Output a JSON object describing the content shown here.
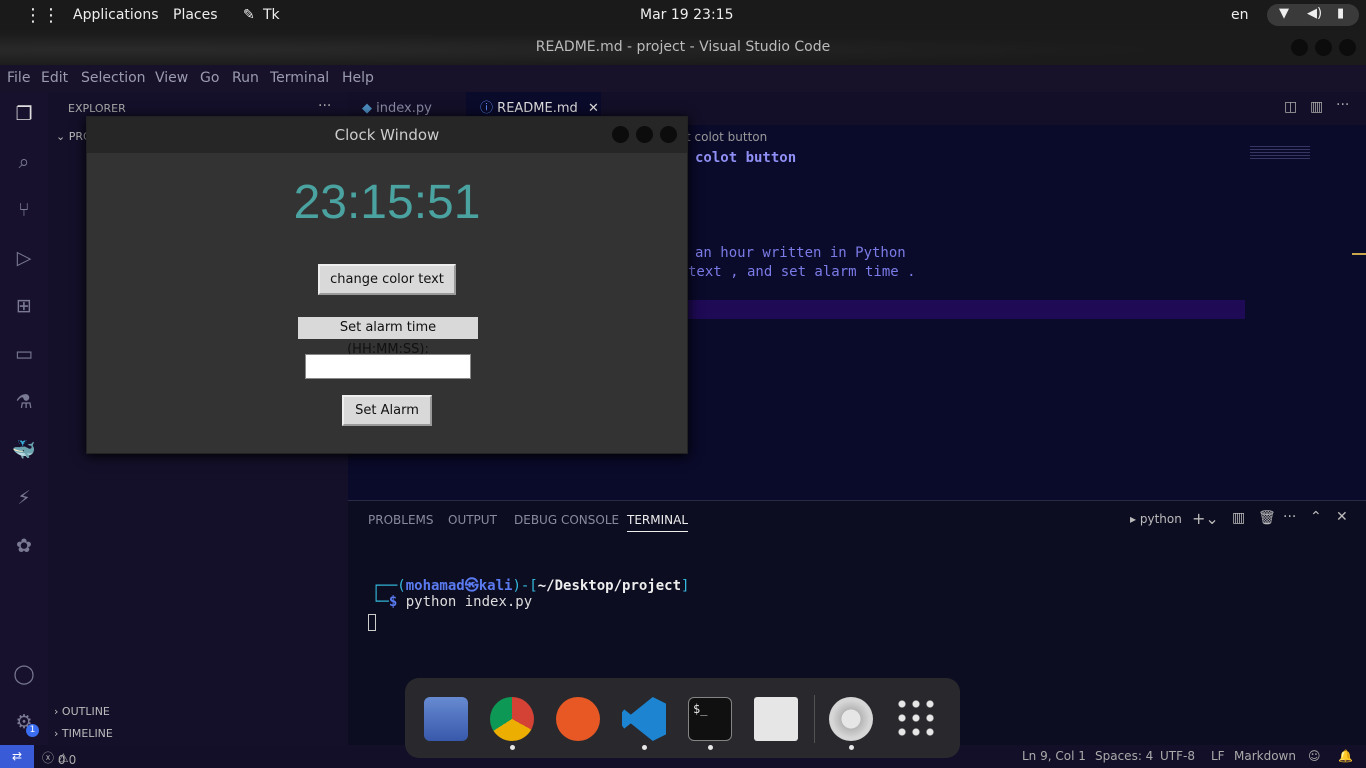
{
  "topbar": {
    "applications": "Applications",
    "places": "Places",
    "active_app": "Tk",
    "datetime": "Mar 19  23:15",
    "language": "en"
  },
  "window": {
    "title": "README.md - project - Visual Studio Code"
  },
  "menu": [
    "File",
    "Edit",
    "Selection",
    "View",
    "Go",
    "Run",
    "Terminal",
    "Help"
  ],
  "sidebar": {
    "explorer_label": "EXPLORER",
    "project_label": "PRO",
    "outline": "OUTLINE",
    "timeline": "TIMELINE",
    "accounts_badge": "1"
  },
  "editor": {
    "tabs": [
      {
        "label": "index.py",
        "icon": "python-icon"
      },
      {
        "label": "README.md",
        "icon": "info-icon"
      }
    ],
    "breadcrumb": "t colot button",
    "lines": {
      "heading": "colot button",
      "line1": "an hour written in Python",
      "line2": "text , and set alarm time ."
    }
  },
  "panel": {
    "tabs": [
      "PROBLEMS",
      "OUTPUT",
      "DEBUG CONSOLE",
      "TERMINAL"
    ],
    "active_tab": "TERMINAL",
    "terminal_name": "python",
    "prompt_user": "mohamad㉿kali",
    "prompt_path": "~/Desktop/project",
    "command": "python index.py"
  },
  "status": {
    "errors": "0",
    "warnings": "0",
    "position": "Ln 9, Col 1",
    "spaces": "Spaces: 4",
    "encoding": "UTF-8",
    "eol": "LF",
    "language": "Markdown"
  },
  "clock_window": {
    "title": "Clock Window",
    "time": "23:15:51",
    "color_button": "change color text",
    "alarm_label": "Set alarm time (HH:MM:SS):",
    "alarm_input_value": "",
    "set_alarm_button": "Set Alarm",
    "time_color": "#4aa3a0"
  },
  "dock": {
    "apps": [
      "files-icon",
      "chrome-icon",
      "postman-icon",
      "vscode-icon",
      "terminal-icon",
      "text-editor-icon",
      "settings-icon",
      "app-grid-icon"
    ]
  },
  "colors": {
    "editor_bg": "#0a0a2a",
    "activity_bg": "#18112e",
    "accent": "#7b7be8"
  }
}
